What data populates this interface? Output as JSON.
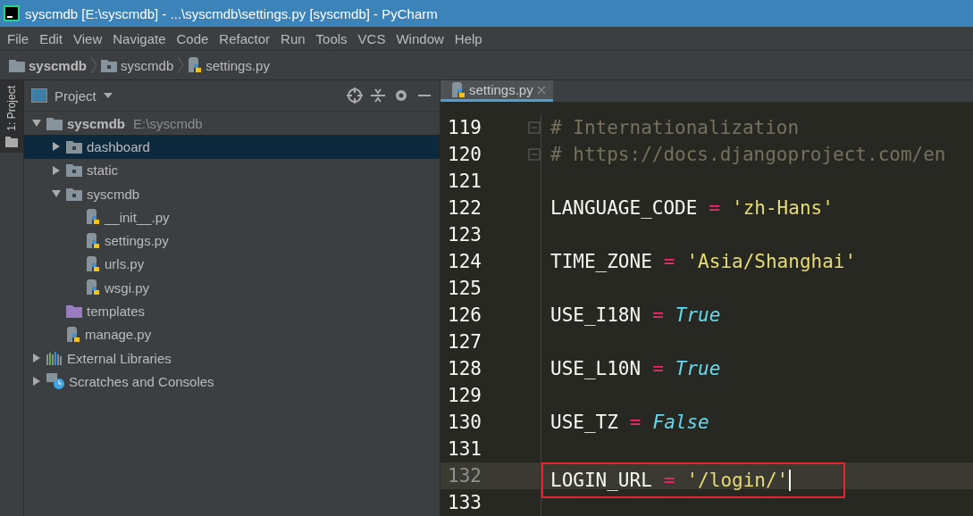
{
  "window": {
    "title": "syscmdb [E:\\syscmdb] - ...\\syscmdb\\settings.py [syscmdb] - PyCharm"
  },
  "menu": [
    "File",
    "Edit",
    "View",
    "Navigate",
    "Code",
    "Refactor",
    "Run",
    "Tools",
    "VCS",
    "Window",
    "Help"
  ],
  "breadcrumb": [
    {
      "label": "syscmdb",
      "kind": "folder"
    },
    {
      "label": "syscmdb",
      "kind": "module"
    },
    {
      "label": "settings.py",
      "kind": "python"
    }
  ],
  "tool_stripe": {
    "label": "1: Project",
    "selected": true
  },
  "project_panel": {
    "title": "Project",
    "tree": [
      {
        "label": "syscmdb",
        "path": "E:\\syscmdb",
        "kind": "folder",
        "expanded": true,
        "selected": false,
        "children": [
          {
            "label": "dashboard",
            "kind": "module",
            "expanded": false,
            "selected": true
          },
          {
            "label": "static",
            "kind": "module",
            "expanded": false,
            "selected": false
          },
          {
            "label": "syscmdb",
            "kind": "module",
            "expanded": true,
            "selected": false,
            "children": [
              {
                "label": "__init__.py",
                "kind": "python",
                "selected": false
              },
              {
                "label": "settings.py",
                "kind": "python",
                "selected": false
              },
              {
                "label": "urls.py",
                "kind": "python",
                "selected": false
              },
              {
                "label": "wsgi.py",
                "kind": "python",
                "selected": false
              }
            ]
          },
          {
            "label": "templates",
            "kind": "templates",
            "selected": false
          },
          {
            "label": "manage.py",
            "kind": "python",
            "selected": false
          }
        ]
      },
      {
        "label": "External Libraries",
        "kind": "libraries",
        "expanded": false,
        "selected": false
      },
      {
        "label": "Scratches and Consoles",
        "kind": "scratches",
        "expanded": false,
        "selected": false
      }
    ]
  },
  "editor": {
    "tabs": [
      {
        "label": "settings.py",
        "selected": true
      }
    ],
    "lines": [
      {
        "number": "119",
        "current": false,
        "tokens": [
          {
            "kind": "comment",
            "text": "# Internationalization"
          }
        ]
      },
      {
        "number": "120",
        "current": false,
        "tokens": [
          {
            "kind": "comment",
            "text": "# https://docs.djangoproject.com/en"
          }
        ]
      },
      {
        "number": "121",
        "current": false
      },
      {
        "number": "122",
        "current": false,
        "tokens": [
          {
            "kind": "name",
            "text": "LANGUAGE_CODE"
          },
          {
            "kind": "op",
            "text": "="
          },
          {
            "kind": "string",
            "text": "'zh-Hans'"
          }
        ]
      },
      {
        "number": "123",
        "current": false
      },
      {
        "number": "124",
        "current": false,
        "tokens": [
          {
            "kind": "name",
            "text": "TIME_ZONE"
          },
          {
            "kind": "op",
            "text": "="
          },
          {
            "kind": "string",
            "text": "'Asia/Shanghai'"
          }
        ]
      },
      {
        "number": "125",
        "current": false
      },
      {
        "number": "126",
        "current": false,
        "tokens": [
          {
            "kind": "name",
            "text": "USE_I18N"
          },
          {
            "kind": "op",
            "text": "="
          },
          {
            "kind": "keyword",
            "text": "True"
          }
        ]
      },
      {
        "number": "127",
        "current": false
      },
      {
        "number": "128",
        "current": false,
        "tokens": [
          {
            "kind": "name",
            "text": "USE_L10N"
          },
          {
            "kind": "op",
            "text": "="
          },
          {
            "kind": "keyword",
            "text": "True"
          }
        ]
      },
      {
        "number": "129",
        "current": false
      },
      {
        "number": "130",
        "current": false,
        "tokens": [
          {
            "kind": "name",
            "text": "USE_TZ"
          },
          {
            "kind": "op",
            "text": "="
          },
          {
            "kind": "keyword",
            "text": "False"
          }
        ]
      },
      {
        "number": "131",
        "current": false
      },
      {
        "number": "132",
        "current": true,
        "highlighted": true,
        "tokens": [
          {
            "kind": "name",
            "text": "LOGIN_URL"
          },
          {
            "kind": "op",
            "text": "="
          },
          {
            "kind": "string",
            "text": "'/login/'"
          }
        ]
      },
      {
        "number": "133",
        "current": false
      }
    ]
  }
}
